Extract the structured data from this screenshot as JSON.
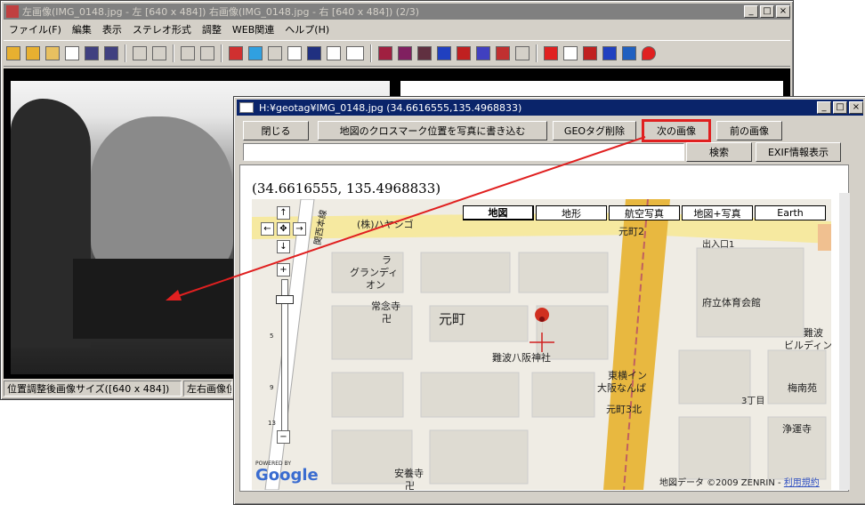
{
  "main_window": {
    "title": "左画像(IMG_0148.jpg - 左 [640 x 484]) 右画像(IMG_0148.jpg - 右 [640 x 484])  (2/3)",
    "menu": [
      "ファイル(F)",
      "編集",
      "表示",
      "ステレオ形式",
      "調整",
      "WEB関連",
      "ヘルプ(H)"
    ],
    "status_left": "位置調整後画像サイズ([640 x 484])",
    "status_right": "左右画像位"
  },
  "geo_window": {
    "title": "H:¥geotag¥IMG_0148.jpg (34.6616555,135.4968833)",
    "buttons": {
      "close": "閉じる",
      "write_crossmark": "地図のクロスマーク位置を写真に書き込む",
      "delete_geotag": "GEOタグ削除",
      "next_image": "次の画像",
      "prev_image": "前の画像",
      "search": "検索",
      "exif": "EXIF情報表示"
    },
    "search_value": "",
    "coords": "(34.6616555, 135.4968833)",
    "map_types": [
      "地図",
      "地形",
      "航空写真",
      "地図+写真",
      "Earth"
    ],
    "map_labels": {
      "hayashigo": "(株)ハヤシゴ",
      "motomachi2": "元町2",
      "exit1": "出入口1",
      "grandi1": "ラ",
      "grandi2": "グランディ",
      "grandi3": "オン",
      "jonenji": "常念寺",
      "jonenji_mark": "卍",
      "motomachi": "元町",
      "gym": "府立体育会館",
      "namba_bldg1": "難波",
      "namba_bldg2": "ビルディン",
      "shrine": "難波八阪神社",
      "toyoko1": "東横イン",
      "toyoko2": "大阪なんば",
      "umenan": "梅南苑",
      "motomachi3n": "元町3北",
      "chome3": "3丁目",
      "shinkyo": "浄運寺",
      "anyoji": "安養寺",
      "anyoji_mark": "卍",
      "road": "関西本線",
      "powered": "POWERED BY",
      "google": "Google",
      "copyright": "地図データ ©2009 ZENRIN - ",
      "terms": "利用規約"
    },
    "zoom_numbers": [
      "5",
      "9",
      "13"
    ]
  }
}
